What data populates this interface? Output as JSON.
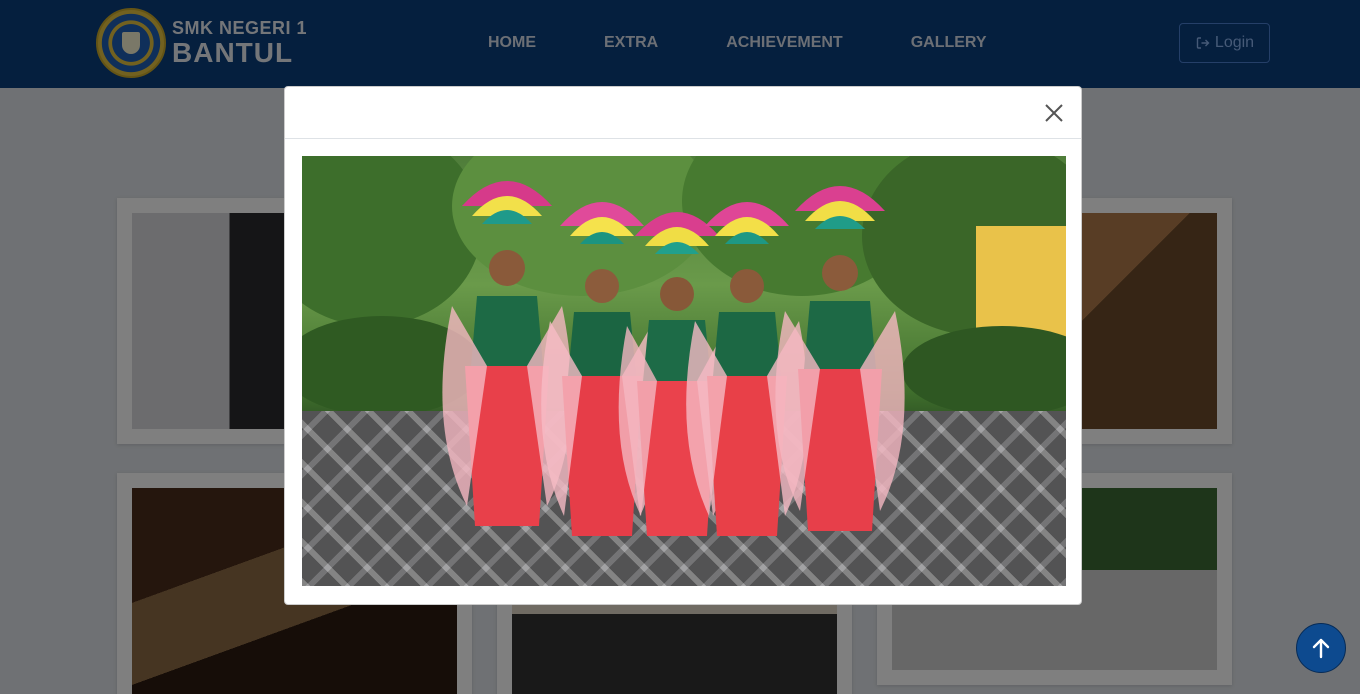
{
  "brand": {
    "line1": "SMK NEGERI 1",
    "line2": "BANTUL",
    "logo_icon": "school-crest-icon"
  },
  "nav": {
    "items": [
      {
        "label": "HOME"
      },
      {
        "label": "EXTRA"
      },
      {
        "label": "ACHIEVEMENT"
      },
      {
        "label": "GALLERY"
      }
    ],
    "login_label": "Login",
    "login_icon": "sign-in-icon"
  },
  "modal": {
    "close_icon": "close-icon",
    "image_alt": "Five dancers in red and green costumes with feathered headdresses"
  },
  "scroll_top_icon": "arrow-up-icon",
  "colors": {
    "navbar": "#0a3e7d",
    "login_border": "#4a7fd0",
    "scroll_button": "#0d4a8f"
  }
}
